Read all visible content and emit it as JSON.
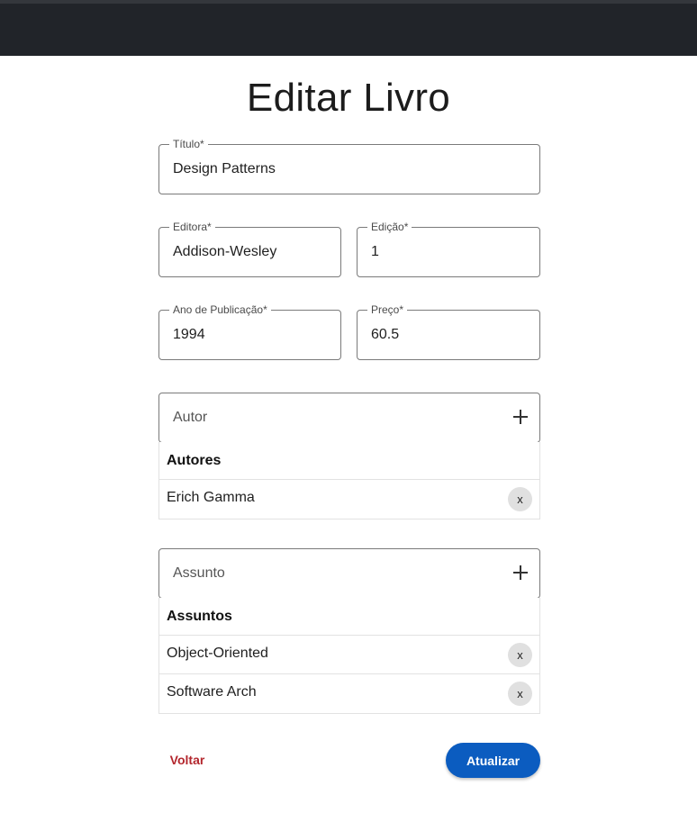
{
  "page": {
    "title": "Editar Livro"
  },
  "form": {
    "titulo": {
      "label": "Título*",
      "value": "Design Patterns"
    },
    "editora": {
      "label": "Editora*",
      "value": "Addison-Wesley"
    },
    "edicao": {
      "label": "Edição*",
      "value": "1"
    },
    "ano_publicacao": {
      "label": "Ano de Publicação*",
      "value": "1994"
    },
    "preco": {
      "label": "Preço*",
      "value": "60.5"
    }
  },
  "autores": {
    "input_placeholder": "Autor",
    "add_icon": "plus-icon",
    "header": "Autores",
    "items": [
      {
        "name": "Erich Gamma",
        "remove_label": "x"
      }
    ]
  },
  "assuntos": {
    "input_placeholder": "Assunto",
    "add_icon": "plus-icon",
    "header": "Assuntos",
    "items": [
      {
        "name": "Object-Oriented",
        "remove_label": "x"
      },
      {
        "name": "Software Arch",
        "remove_label": "x"
      }
    ]
  },
  "actions": {
    "back_label": "Voltar",
    "submit_label": "Atualizar"
  },
  "colors": {
    "topbar": "#212429",
    "primary": "#0b5cc0",
    "danger_text": "#b3262d"
  }
}
